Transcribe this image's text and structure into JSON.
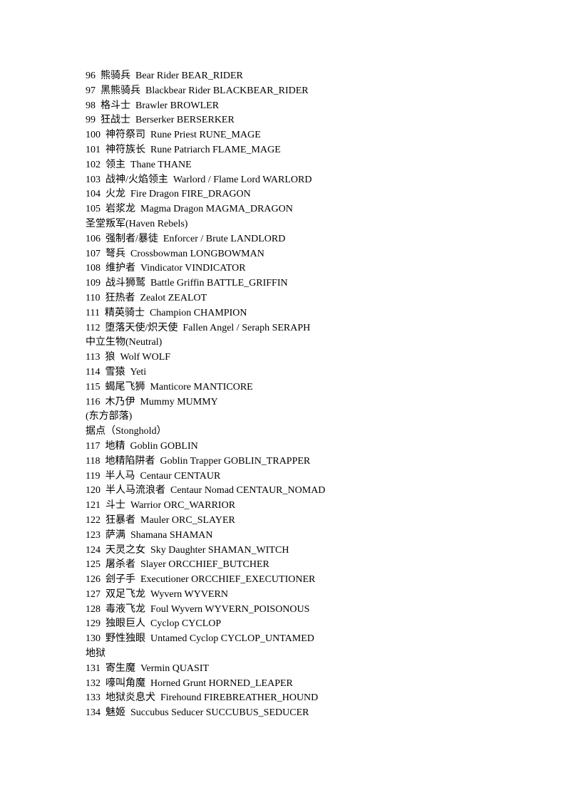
{
  "document": {
    "lines": [
      "96  熊骑兵  Bear Rider BEAR_RIDER",
      "97  黑熊骑兵  Blackbear Rider BLACKBEAR_RIDER",
      "98  格斗士  Brawler BROWLER",
      "99  狂战士  Berserker BERSERKER",
      "100  神符祭司  Rune Priest RUNE_MAGE",
      "101  神符族长  Rune Patriarch FLAME_MAGE",
      "102  领主  Thane THANE",
      "103  战神/火焰领主  Warlord / Flame Lord WARLORD",
      "104  火龙  Fire Dragon FIRE_DRAGON",
      "105  岩浆龙  Magma Dragon MAGMA_DRAGON",
      "圣堂叛军(Haven Rebels)",
      "106  强制者/暴徒  Enforcer / Brute LANDLORD",
      "107  弩兵  Crossbowman LONGBOWMAN",
      "108  维护者  Vindicator VINDICATOR",
      "109  战斗狮鹫  Battle Griffin BATTLE_GRIFFIN",
      "110  狂热者  Zealot ZEALOT",
      "111  精英骑士  Champion CHAMPION",
      "112  堕落天使/炽天使  Fallen Angel / Seraph SERAPH",
      "中立生物(Neutral)",
      "113  狼  Wolf WOLF",
      "114  雪猿  Yeti",
      "115  蝎尾飞狮  Manticore MANTICORE",
      "116  木乃伊  Mummy MUMMY",
      "(东方部落)",
      "据点（Stonghold）",
      "117  地精  Goblin GOBLIN",
      "118  地精陷阱者  Goblin Trapper GOBLIN_TRAPPER",
      "119  半人马  Centaur CENTAUR",
      "120  半人马流浪者  Centaur Nomad CENTAUR_NOMAD",
      "121  斗士  Warrior ORC_WARRIOR",
      "122  狂暴者  Mauler ORC_SLAYER",
      "123  萨满  Shamana SHAMAN",
      "124  天灵之女  Sky Daughter SHAMAN_WITCH",
      "125  屠杀者  Slayer ORCCHIEF_BUTCHER",
      "126  刽子手  Executioner ORCCHIEF_EXECUTIONER",
      "127  双足飞龙  Wyvern WYVERN",
      "128  毒液飞龙  Foul Wyvern WYVERN_POISONOUS",
      "129  独眼巨人  Cyclop CYCLOP",
      "130  野性独眼  Untamed Cyclop CYCLOP_UNTAMED",
      "地狱",
      "131  寄生魔  Vermin QUASIT",
      "132  嚎叫角魔  Horned Grunt HORNED_LEAPER",
      "133  地狱炎息犬  Firehound FIREBREATHER_HOUND",
      "134  魅姬  Succubus Seducer SUCCUBUS_SEDUCER"
    ]
  }
}
